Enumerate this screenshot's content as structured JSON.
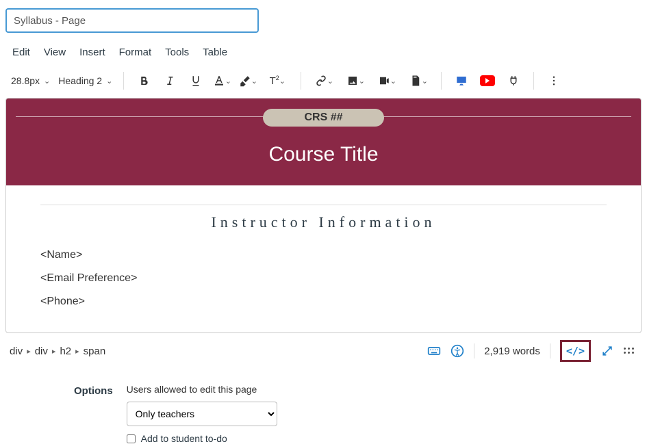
{
  "title_value": "Syllabus - Page",
  "title_placeholder": "Syllabus - Page",
  "menubar": {
    "edit": "Edit",
    "view": "View",
    "insert": "Insert",
    "format": "Format",
    "tools": "Tools",
    "table": "Table"
  },
  "toolbar": {
    "font_size": "28.8px",
    "block_format": "Heading 2"
  },
  "banner": {
    "crs": "CRS ##",
    "course_title": "Course Title"
  },
  "section": {
    "heading": "Instructor Information",
    "name": "<Name>",
    "email": "<Email Preference>",
    "phone": "<Phone>"
  },
  "breadcrumb": {
    "a": "div",
    "b": "div",
    "c": "h2",
    "d": "span"
  },
  "status": {
    "words": "2,919 words"
  },
  "options": {
    "label": "Options",
    "caption": "Users allowed to edit this page",
    "select_value": "Only teachers",
    "checkbox_label": "Add to student to-do"
  }
}
